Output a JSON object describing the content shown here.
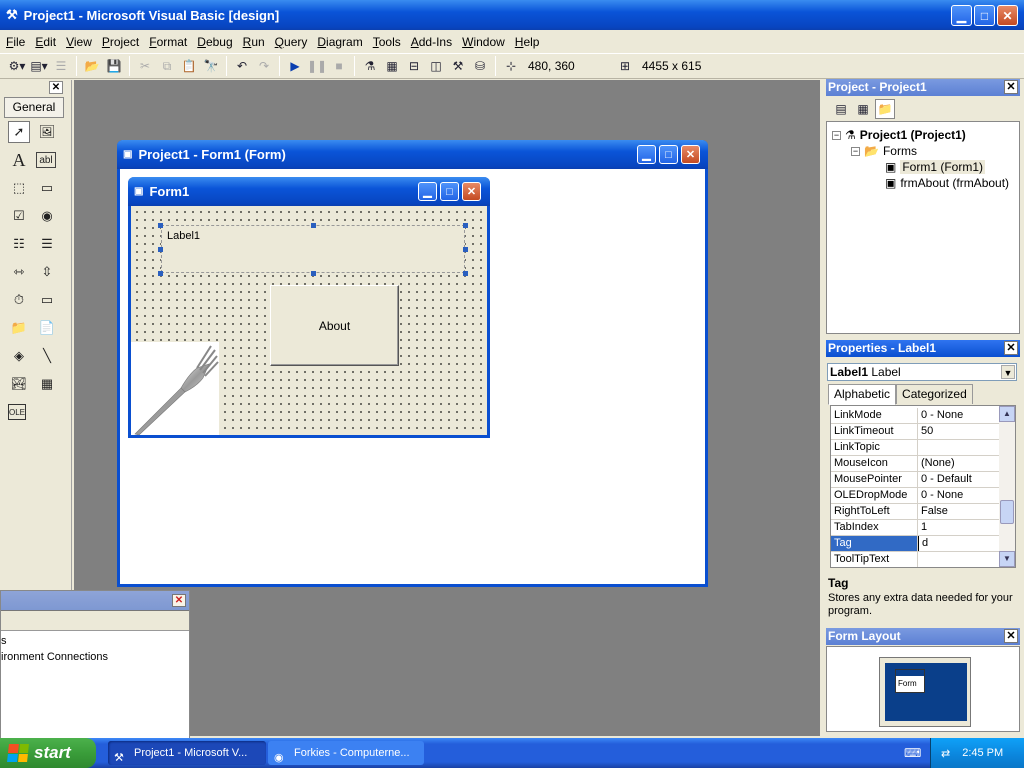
{
  "app": {
    "title": "Project1 - Microsoft Visual Basic [design]"
  },
  "menu": [
    "File",
    "Edit",
    "View",
    "Project",
    "Format",
    "Debug",
    "Run",
    "Query",
    "Diagram",
    "Tools",
    "Add-Ins",
    "Window",
    "Help"
  ],
  "toolbar": {
    "position_readout": "480, 360",
    "size_readout": "4455 x 615"
  },
  "toolbox": {
    "tab_label": "General"
  },
  "designer": {
    "title": "Project1 - Form1 (Form)"
  },
  "form1": {
    "title": "Form1",
    "label1_text": "Label1",
    "about_button": "About"
  },
  "bottom_pane": {
    "items": [
      "s",
      "ironment Connections"
    ]
  },
  "project": {
    "title": "Project - Project1",
    "tree": {
      "root": "Project1 (Project1)",
      "folder": "Forms",
      "items": [
        "Form1 (Form1)",
        "frmAbout (frmAbout)"
      ]
    }
  },
  "properties": {
    "title": "Properties - Label1",
    "object_name": "Label1",
    "object_type": "Label",
    "tabs": [
      "Alphabetic",
      "Categorized"
    ],
    "rows": [
      {
        "name": "LinkMode",
        "value": "0 - None"
      },
      {
        "name": "LinkTimeout",
        "value": "50"
      },
      {
        "name": "LinkTopic",
        "value": ""
      },
      {
        "name": "MouseIcon",
        "value": "(None)"
      },
      {
        "name": "MousePointer",
        "value": "0 - Default"
      },
      {
        "name": "OLEDropMode",
        "value": "0 - None"
      },
      {
        "name": "RightToLeft",
        "value": "False"
      },
      {
        "name": "TabIndex",
        "value": "1"
      },
      {
        "name": "Tag",
        "value": "d"
      },
      {
        "name": "ToolTipText",
        "value": ""
      }
    ],
    "selected": "Tag",
    "description_title": "Tag",
    "description": "Stores any extra data needed for your program."
  },
  "form_layout": {
    "title": "Form Layout",
    "mini_form_label": "Form"
  },
  "taskbar": {
    "start": "start",
    "tasks": [
      "Project1 - Microsoft V...",
      "Forkies - Computerne..."
    ],
    "clock": "2:45 PM"
  },
  "colors": {
    "xp_blue": "#0A54D8",
    "start_green": "#3A9D3A",
    "selection": "#316AC5"
  }
}
